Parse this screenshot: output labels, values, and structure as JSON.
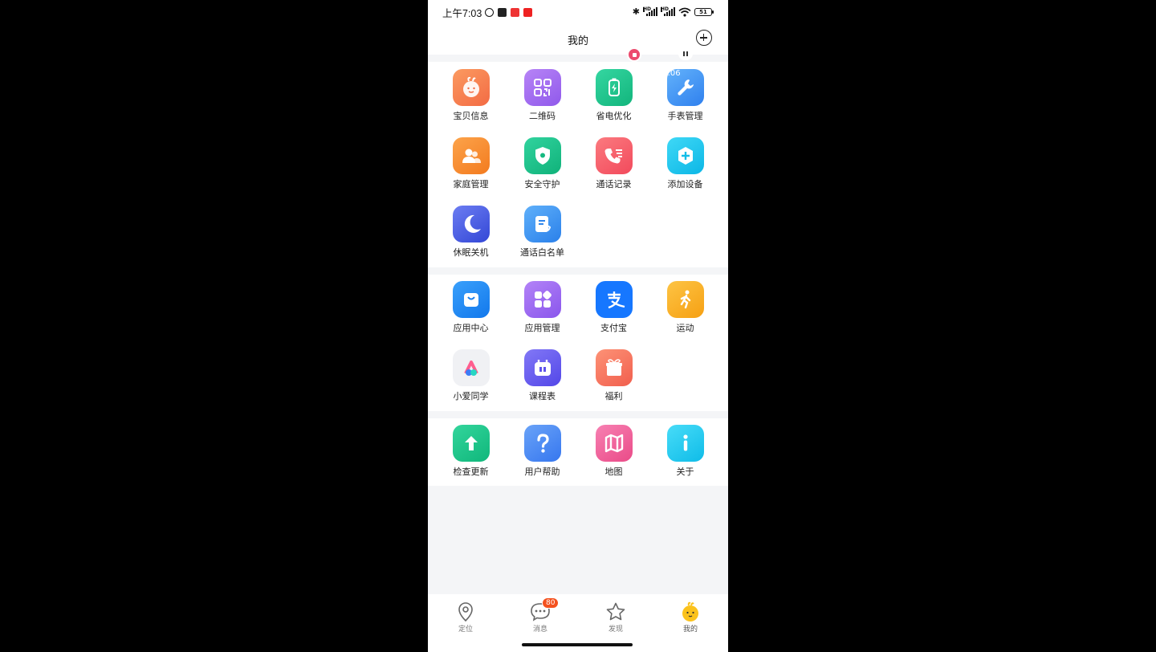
{
  "status_bar": {
    "time": "上午7:03",
    "battery": "51",
    "network_label": "HD"
  },
  "header": {
    "title": "我的"
  },
  "section1": {
    "items": [
      {
        "label": "宝贝信息",
        "icon": "baby-face-icon",
        "color": "#f97b4f"
      },
      {
        "label": "二维码",
        "icon": "qr-code-icon",
        "color": "#a26cf0"
      },
      {
        "label": "省电优化",
        "icon": "battery-icon",
        "color": "#1dc28a"
      },
      {
        "label": "手表管理",
        "icon": "wrench-icon",
        "color": "#3a8ef5",
        "overlay": ":06"
      },
      {
        "label": "家庭管理",
        "icon": "family-icon",
        "color": "#f98a2c"
      },
      {
        "label": "安全守护",
        "icon": "shield-icon",
        "color": "#1bc68a"
      },
      {
        "label": "通话记录",
        "icon": "call-log-icon",
        "color": "#f85a6b"
      },
      {
        "label": "添加设备",
        "icon": "add-device-icon",
        "color": "#15c6ef"
      },
      {
        "label": "休眠关机",
        "icon": "moon-icon",
        "color": "#4b63e6"
      },
      {
        "label": "通话白名单",
        "icon": "whitelist-icon",
        "color": "#3d93f2"
      }
    ]
  },
  "section2": {
    "items": [
      {
        "label": "应用中心",
        "icon": "shopping-bag-icon",
        "color": "#1f8cf5"
      },
      {
        "label": "应用管理",
        "icon": "apps-icon",
        "color": "#9c65f2"
      },
      {
        "label": "支付宝",
        "icon": "alipay-icon",
        "color": "#1677ff"
      },
      {
        "label": "运动",
        "icon": "running-icon",
        "color": "#fbb328"
      },
      {
        "label": "小爱同学",
        "icon": "xiaoai-icon",
        "color": "#f2f3f5"
      },
      {
        "label": "课程表",
        "icon": "schedule-icon",
        "color": "#6d62f0"
      },
      {
        "label": "福利",
        "icon": "gift-icon",
        "color": "#f97a5b"
      }
    ]
  },
  "section3": {
    "items": [
      {
        "label": "检查更新",
        "icon": "arrow-up-icon",
        "color": "#1cc889"
      },
      {
        "label": "用户帮助",
        "icon": "help-icon",
        "color": "#4c8df5"
      },
      {
        "label": "地图",
        "icon": "map-icon",
        "color": "#f15f9a"
      },
      {
        "label": "关于",
        "icon": "info-icon",
        "color": "#15c9f0"
      }
    ]
  },
  "bottom_nav": {
    "items": [
      {
        "label": "定位",
        "icon": "location-pin-icon"
      },
      {
        "label": "消息",
        "icon": "chat-bubble-icon",
        "badge": "80"
      },
      {
        "label": "发现",
        "icon": "star-icon"
      },
      {
        "label": "我的",
        "icon": "mascot-icon",
        "active": true
      }
    ]
  }
}
